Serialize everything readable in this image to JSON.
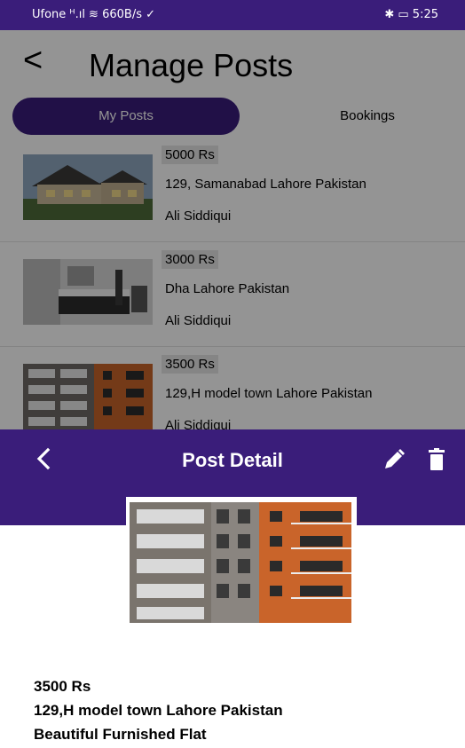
{
  "status_bar": {
    "left": "Ufone ᴴ.ıl ≋ 660B/s ✓",
    "right": "✱ ▭ 5:25"
  },
  "manage_posts": {
    "back_icon": "chevron-left-icon",
    "title": "Manage Posts",
    "tabs": [
      {
        "label": "My Posts",
        "active": true
      },
      {
        "label": "Bookings",
        "active": false
      }
    ],
    "posts": [
      {
        "price": "5000 Rs",
        "address": "129, Samanabad Lahore Pakistan",
        "owner": "Ali Siddiqui",
        "image": "house-photo"
      },
      {
        "price": "3000 Rs",
        "address": "Dha Lahore Pakistan",
        "owner": "Ali Siddiqui",
        "image": "bedroom-photo"
      },
      {
        "price": "3500 Rs",
        "address": "129,H model town Lahore Pakistan",
        "owner": "Ali Siddiqui",
        "image": "apartment-building-photo"
      }
    ]
  },
  "post_detail": {
    "title": "Post Detail",
    "back_icon": "chevron-left-icon",
    "edit_icon": "pencil-icon",
    "delete_icon": "trash-icon",
    "image": "apartment-building-photo",
    "price": "3500 Rs",
    "address": "129,H model town Lahore Pakistan",
    "description": "Beautiful Furnished Flat"
  },
  "colors": {
    "primary": "#3a1d7a",
    "overlay": "rgba(0,0,0,0.42)",
    "price_chip": "#e6e6e6"
  }
}
